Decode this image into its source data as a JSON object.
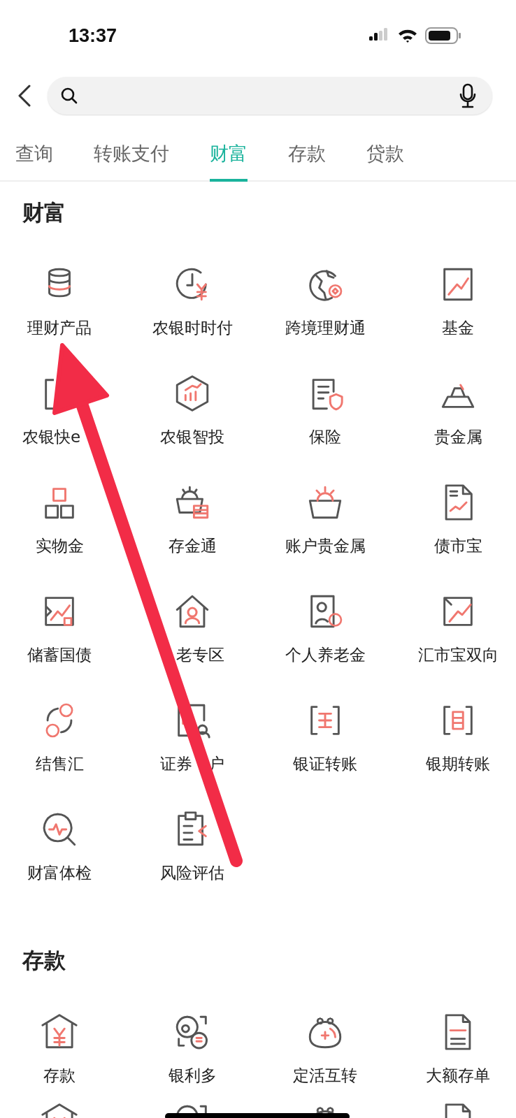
{
  "status_bar": {
    "time": "13:37"
  },
  "tabs": [
    {
      "label": "查询",
      "selected": false
    },
    {
      "label": "转账支付",
      "selected": false
    },
    {
      "label": "财富",
      "selected": true
    },
    {
      "label": "存款",
      "selected": false
    },
    {
      "label": "贷款",
      "selected": false
    }
  ],
  "sections": [
    {
      "title": "财富",
      "items": [
        {
          "kind": "plain",
          "label": "理财产品"
        },
        {
          "kind": "plain",
          "label": "农银时时付"
        },
        {
          "kind": "plain",
          "label": "跨境理财通"
        },
        {
          "kind": "plain",
          "label": "基金"
        },
        {
          "kind": "covered_end",
          "label": "农银快e"
        },
        {
          "kind": "plain",
          "label": "农银智投"
        },
        {
          "kind": "plain",
          "label": "保险"
        },
        {
          "kind": "plain",
          "label": "贵金属"
        },
        {
          "kind": "plain",
          "label": "实物金"
        },
        {
          "kind": "plain",
          "label": "存金通"
        },
        {
          "kind": "plain",
          "label": "账户贵金属"
        },
        {
          "kind": "plain",
          "label": "债市宝"
        },
        {
          "kind": "plain",
          "label": "储蓄国债"
        },
        {
          "kind": "covered_start",
          "label": "老专区"
        },
        {
          "kind": "plain",
          "label": "个人养老金"
        },
        {
          "kind": "plain",
          "label": "汇市宝双向"
        },
        {
          "kind": "plain",
          "label": "结售汇"
        },
        {
          "kind": "covered_middle",
          "label": "证券",
          "label_after": "户"
        },
        {
          "kind": "plain",
          "label": "银证转账"
        },
        {
          "kind": "plain",
          "label": "银期转账"
        },
        {
          "kind": "plain",
          "label": "财富体检"
        },
        {
          "kind": "plain",
          "label": "风险评估"
        }
      ]
    },
    {
      "title": "存款",
      "items": [
        {
          "kind": "plain",
          "label": "存款"
        },
        {
          "kind": "plain",
          "label": "银利多"
        },
        {
          "kind": "plain",
          "label": "定活互转"
        },
        {
          "kind": "plain",
          "label": "大额存单"
        }
      ]
    }
  ],
  "annotation": {
    "kind": "arrow"
  }
}
